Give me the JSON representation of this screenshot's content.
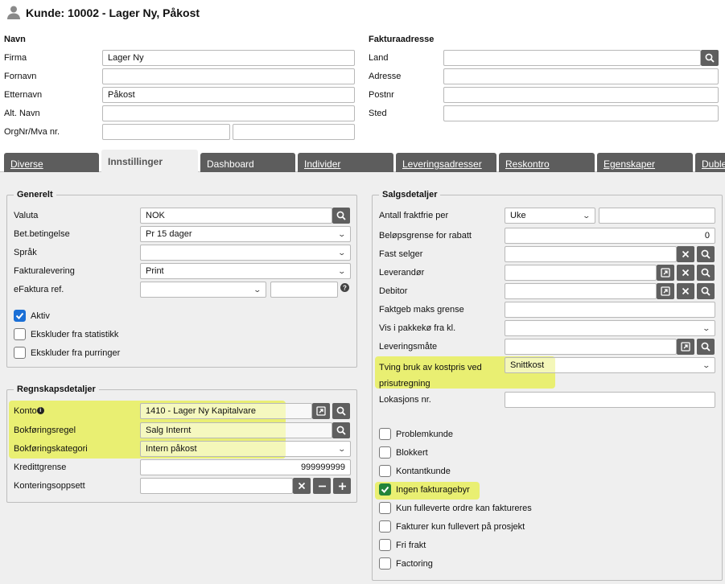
{
  "title": {
    "icon": "user-icon",
    "text": "Kunde: 10002 - Lager Ny, Påkost"
  },
  "navn": {
    "heading": "Navn",
    "firma_label": "Firma",
    "firma_value": "Lager Ny",
    "fornavn_label": "Fornavn",
    "fornavn_value": "",
    "etternavn_label": "Etternavn",
    "etternavn_value": "Påkost",
    "altnavn_label": "Alt. Navn",
    "altnavn_value": "",
    "orgnr_label": "OrgNr/Mva nr.",
    "orgnr_value": "",
    "mva_value": ""
  },
  "faktura": {
    "heading": "Fakturaadresse",
    "land_label": "Land",
    "adresse_label": "Adresse",
    "postnr_label": "Postnr",
    "sted_label": "Sted"
  },
  "tabs": [
    "Diverse",
    "Innstillinger",
    "Dashboard",
    "Individer",
    "Leveringsadresser",
    "Reskontro",
    "Egenskaper",
    "Duble"
  ],
  "active_tab": "Innstillinger",
  "generelt": {
    "legend": "Generelt",
    "valuta_label": "Valuta",
    "valuta_value": "NOK",
    "bet_label": "Bet.betingelse",
    "bet_value": "Pr 15 dager",
    "sprak_label": "Språk",
    "sprak_value": "",
    "fakturalevering_label": "Fakturalevering",
    "fakturalevering_value": "Print",
    "efaktura_label": "eFaktura ref.",
    "efaktura_value": "",
    "aktiv_label": "Aktiv",
    "aktiv_checked": true,
    "ekskl_stat_label": "Ekskluder fra statistikk",
    "ekskl_stat_checked": false,
    "ekskl_purr_label": "Ekskluder fra purringer",
    "ekskl_purr_checked": false
  },
  "regnskap": {
    "legend": "Regnskapsdetaljer",
    "konto_label": "Konto",
    "konto_value": "1410 - Lager Ny Kapitalvare",
    "bokregel_label": "Bokføringsregel",
    "bokregel_value": "Salg Internt",
    "bokkat_label": "Bokføringskategori",
    "bokkat_value": "Intern påkost",
    "kreditt_label": "Kredittgrense",
    "kreditt_value": "999999999",
    "kontering_label": "Konteringsoppsett",
    "kontering_value": ""
  },
  "salg": {
    "legend": "Salgsdetaljer",
    "fraktfrie_label": "Antall fraktfrie per",
    "fraktfrie_value": "Uke",
    "fraktfrie_count": "",
    "belop_label": "Beløpsgrense for rabatt",
    "belop_value": "0",
    "selger_label": "Fast selger",
    "leverandor_label": "Leverandør",
    "debitor_label": "Debitor",
    "faktgeb_label": "Faktgeb maks grense",
    "pakkeko_label": "Vis i pakkekø fra kl.",
    "levmate_label": "Leveringsmåte",
    "tving_label": "Tving bruk av kostpris ved prisutregning",
    "tving_value": "Snittkost",
    "lokasjon_label": "Lokasjons nr.",
    "checks": [
      {
        "label": "Problemkunde",
        "checked": false
      },
      {
        "label": "Blokkert",
        "checked": false
      },
      {
        "label": "Kontantkunde",
        "checked": false
      },
      {
        "label": "Ingen fakturagebyr",
        "checked": true
      },
      {
        "label": "Kun fulleverte ordre kan faktureres",
        "checked": false
      },
      {
        "label": "Fakturer kun fullevert på prosjekt",
        "checked": false
      },
      {
        "label": "Fri frakt",
        "checked": false
      },
      {
        "label": "Factoring",
        "checked": false
      }
    ]
  },
  "colors": {
    "highlight": "#e7ef5c",
    "button": "#5f5f5f",
    "tab": "#5d5d5d",
    "check_blue": "#1a6fd6",
    "check_green": "#22843a"
  }
}
